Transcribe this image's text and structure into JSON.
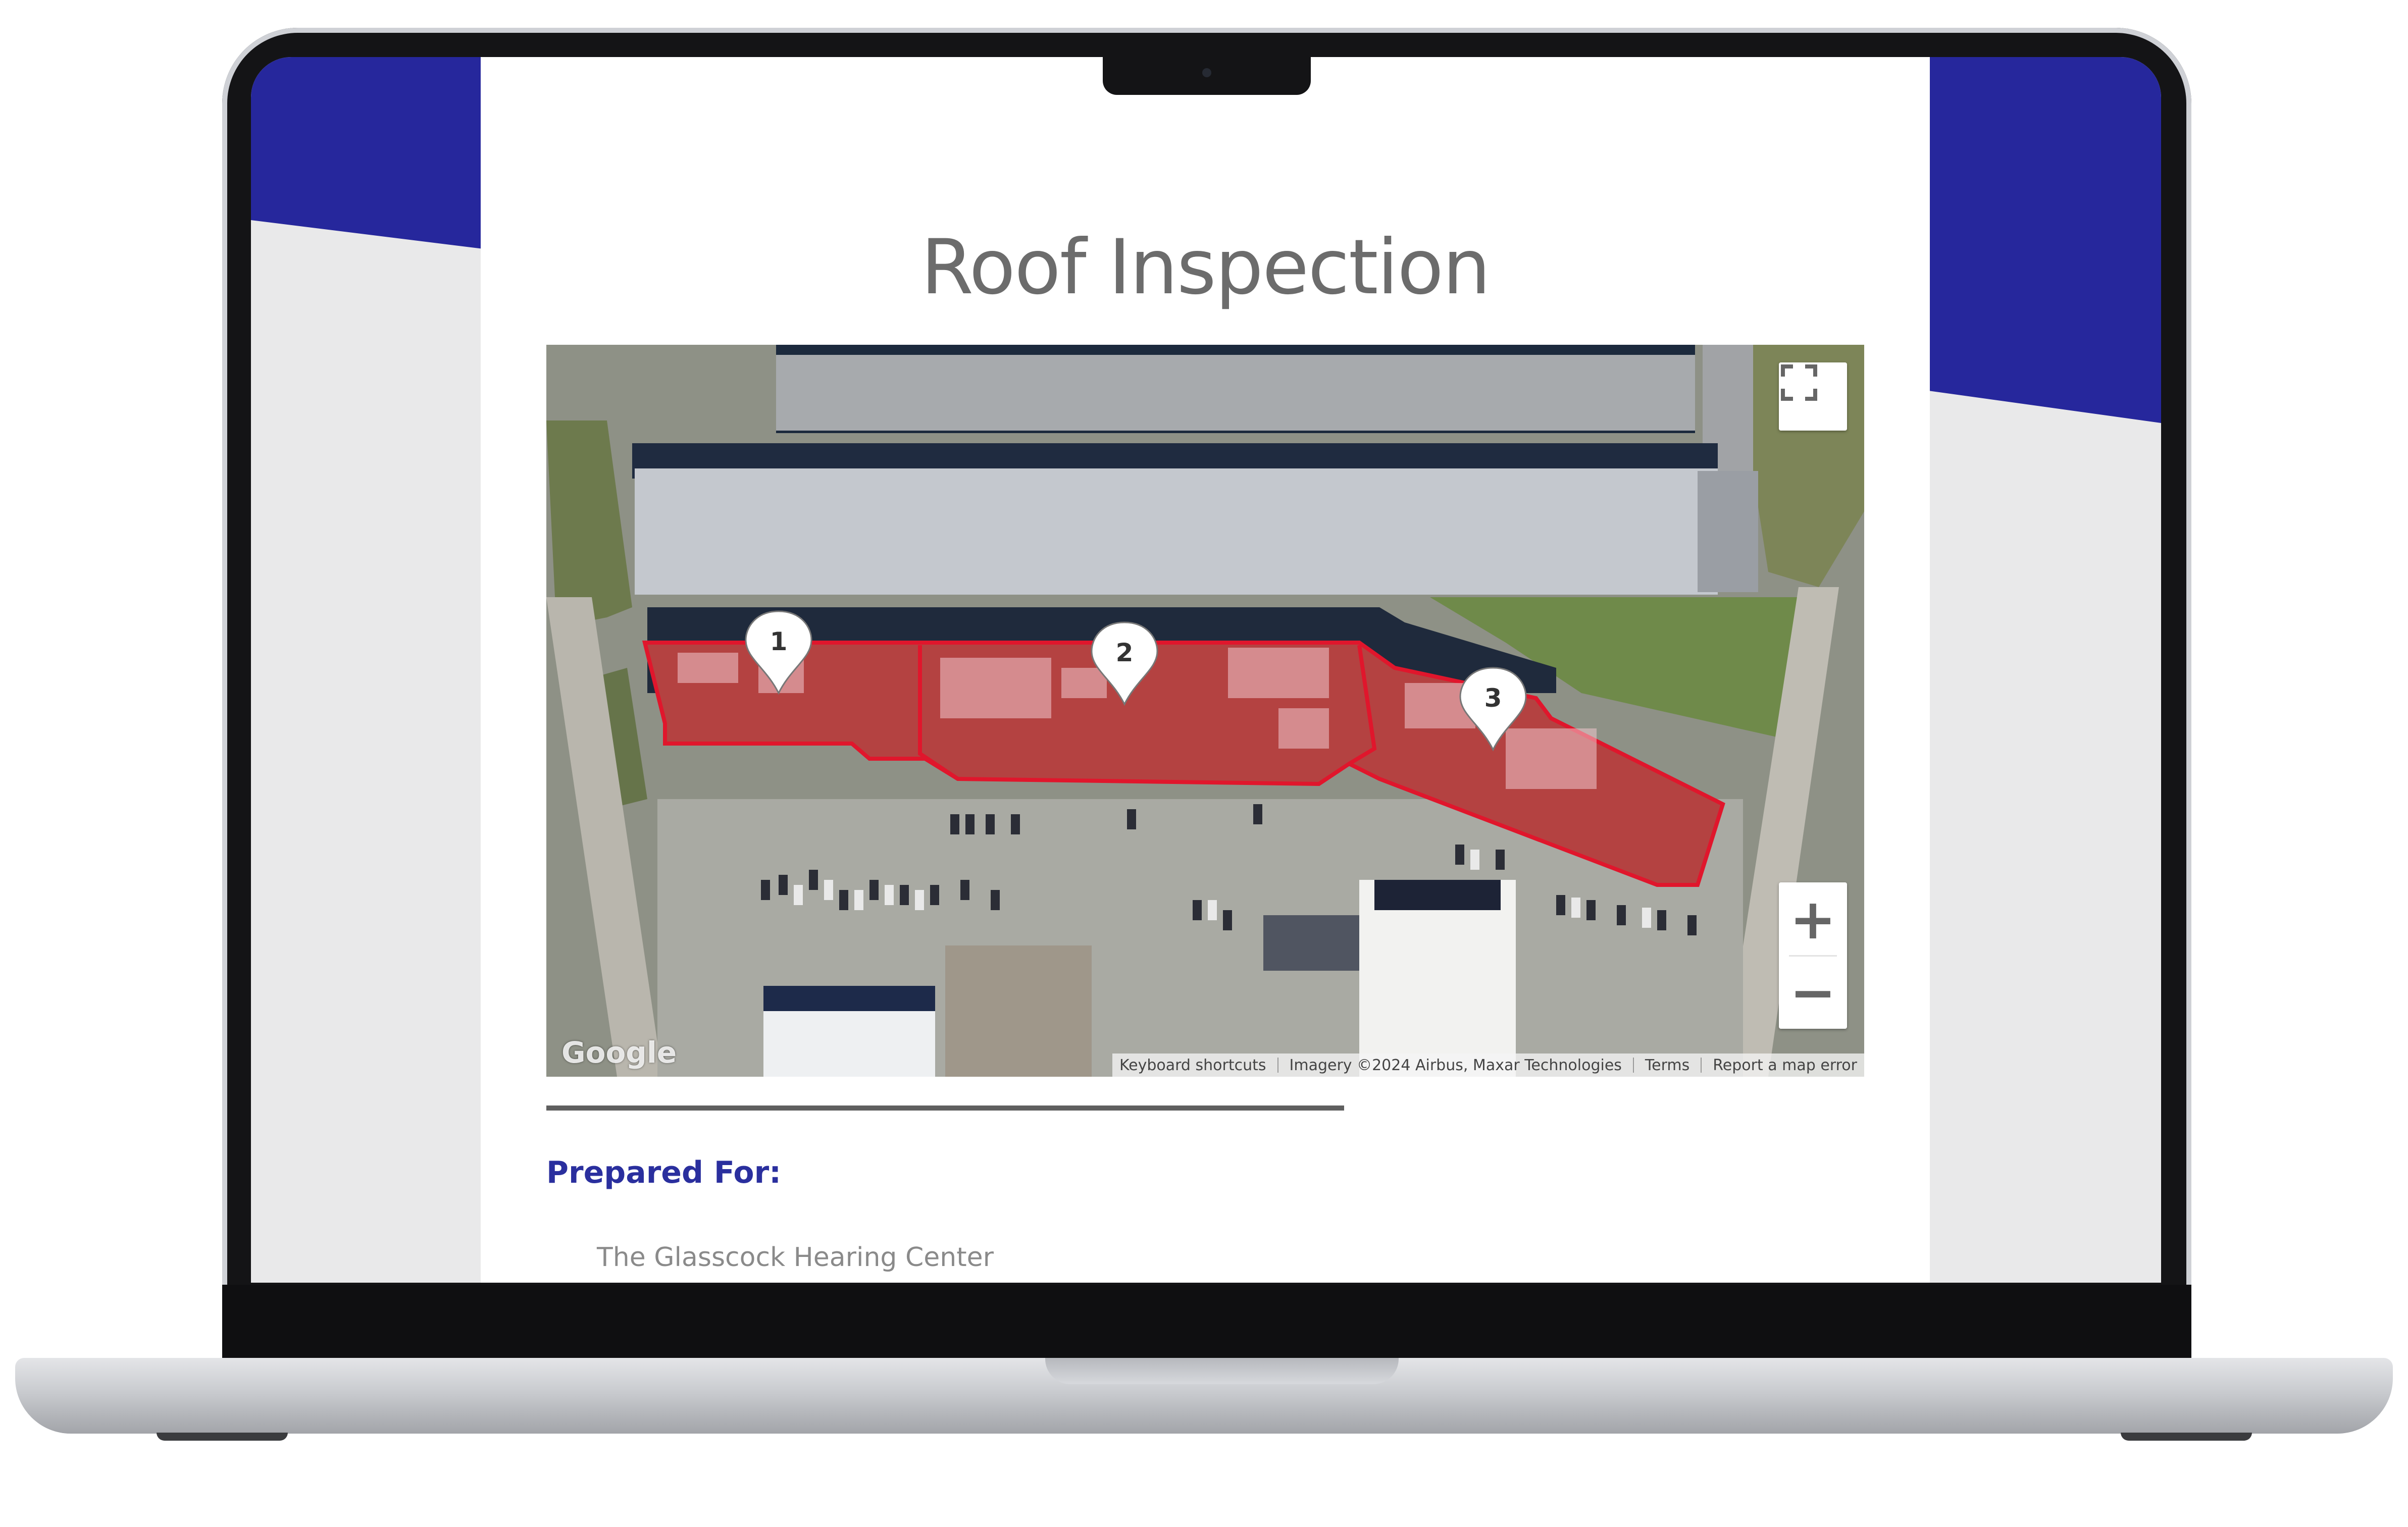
{
  "document": {
    "title": "Roof Inspection",
    "prepared_for_label": "Prepared For:",
    "client_name": "The Glasscock Hearing Center"
  },
  "map": {
    "google_logo": "Google",
    "attribution": {
      "keyboard_shortcuts": "Keyboard shortcuts",
      "imagery": "Imagery ©2024 Airbus, Maxar Technologies",
      "terms": "Terms",
      "report_error": "Report a map error"
    },
    "markers": [
      "1",
      "2",
      "3"
    ],
    "zoom_in_label": "+",
    "zoom_out_label": "−",
    "fullscreen_icon": "fullscreen-icon"
  },
  "colors": {
    "brand_blue": "#26279c",
    "roof_highlight": "#e0162c",
    "title_gray": "#6c6c6c"
  }
}
